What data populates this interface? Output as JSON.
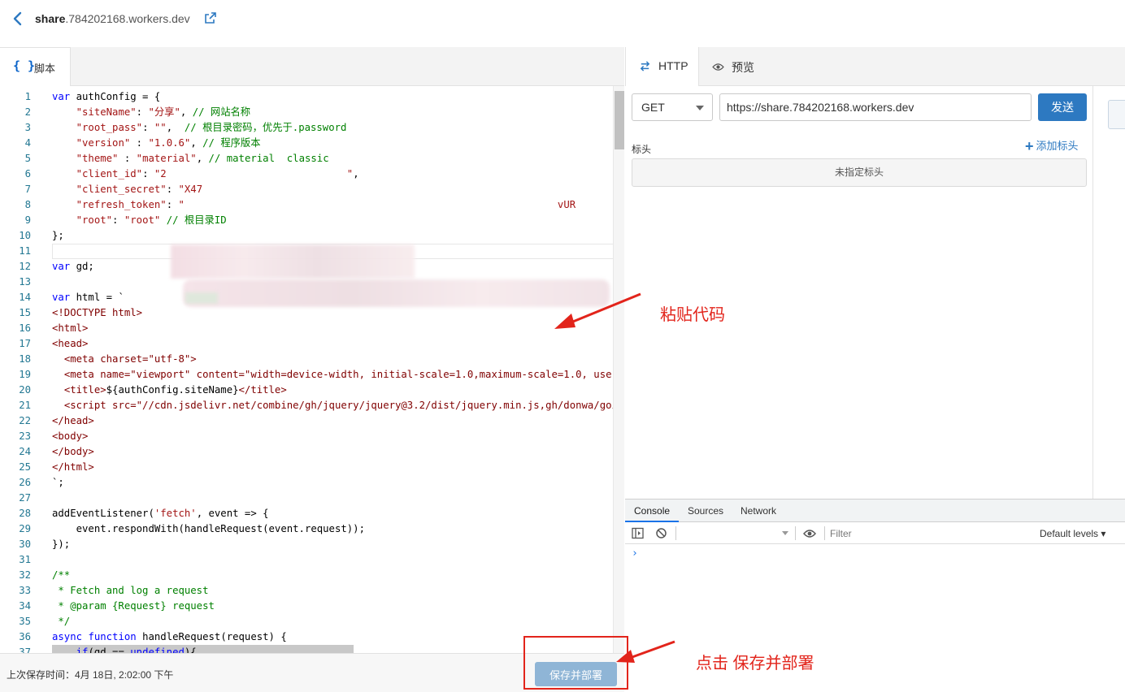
{
  "header": {
    "site_bold": "share",
    "site_rest": ".784202168.workers.dev"
  },
  "editor": {
    "tab_braces": "{ }",
    "tab_label": "脚本",
    "lines": [
      {
        "n": "1",
        "html": "<span class=\"k\">var</span> authConfig = {"
      },
      {
        "n": "2",
        "html": "    <span class=\"s\">\"siteName\"</span>: <span class=\"s\">\"分享\"</span>, <span class=\"c\">// 网站名称</span>"
      },
      {
        "n": "3",
        "html": "    <span class=\"s\">\"root_pass\"</span>: <span class=\"s\">\"\"</span>,  <span class=\"c\">// 根目录密码，优先于.password</span>"
      },
      {
        "n": "4",
        "html": "    <span class=\"s\">\"version\"</span> : <span class=\"s\">\"1.0.6\"</span>, <span class=\"c\">// 程序版本</span>"
      },
      {
        "n": "5",
        "html": "    <span class=\"s\">\"theme\"</span> : <span class=\"s\">\"material\"</span>, <span class=\"c\">// material  classic</span>"
      },
      {
        "n": "6",
        "html": "    <span class=\"s\">\"client_id\"</span>: <span class=\"s\">\"2                              \"</span>,"
      },
      {
        "n": "7",
        "html": "    <span class=\"s\">\"client_secret\"</span>: <span class=\"s\">\"X47</span>"
      },
      {
        "n": "8",
        "html": "    <span class=\"s\">\"refresh_token\"</span>: <span class=\"s\">\"                                                              vUR</span>"
      },
      {
        "n": "9",
        "html": "    <span class=\"s\">\"root\"</span>: <span class=\"s\">\"root\"</span> <span class=\"c\">// 根目录ID</span>"
      },
      {
        "n": "10",
        "html": "};"
      },
      {
        "n": "11",
        "html": "",
        "current": true
      },
      {
        "n": "12",
        "html": "<span class=\"k\">var</span> gd;"
      },
      {
        "n": "13",
        "html": ""
      },
      {
        "n": "14",
        "html": "<span class=\"k\">var</span> html = `"
      },
      {
        "n": "15",
        "html": "<span class=\"t\">&lt;!DOCTYPE html&gt;</span>"
      },
      {
        "n": "16",
        "html": "<span class=\"t\">&lt;html&gt;</span>"
      },
      {
        "n": "17",
        "html": "<span class=\"t\">&lt;head&gt;</span>"
      },
      {
        "n": "18",
        "html": "  <span class=\"t\">&lt;meta charset=\"utf-8\"&gt;</span>"
      },
      {
        "n": "19",
        "html": "  <span class=\"t\">&lt;meta name=\"viewport\" content=\"width=device-width, initial-scale=1.0,maximum-scale=1.0, user-scalable=no\"/&gt;</span>"
      },
      {
        "n": "20",
        "html": "  <span class=\"t\">&lt;title&gt;</span>${authConfig.siteName}<span class=\"t\">&lt;/title&gt;</span>"
      },
      {
        "n": "21",
        "html": "  <span class=\"t\">&lt;script src=\"//cdn.jsdelivr.net/combine/gh/jquery/jquery@3.2/dist/jquery.min.js,gh/donwa/goindex\"&gt;</span>"
      },
      {
        "n": "22",
        "html": "<span class=\"t\">&lt;/head&gt;</span>"
      },
      {
        "n": "23",
        "html": "<span class=\"t\">&lt;body&gt;</span>"
      },
      {
        "n": "24",
        "html": "<span class=\"t\">&lt;/body&gt;</span>"
      },
      {
        "n": "25",
        "html": "<span class=\"t\">&lt;/html&gt;</span>"
      },
      {
        "n": "26",
        "html": "`;"
      },
      {
        "n": "27",
        "html": ""
      },
      {
        "n": "28",
        "html": "addEventListener(<span class=\"s\">'fetch'</span>, event =&gt; {"
      },
      {
        "n": "29",
        "html": "    event.respondWith(handleRequest(event.request));"
      },
      {
        "n": "30",
        "html": "});"
      },
      {
        "n": "31",
        "html": ""
      },
      {
        "n": "32",
        "html": "<span class=\"c\">/**</span>"
      },
      {
        "n": "33",
        "html": "<span class=\"c\"> * Fetch and log a request</span>"
      },
      {
        "n": "34",
        "html": "<span class=\"c\"> * @param {Request} request</span>"
      },
      {
        "n": "35",
        "html": "<span class=\"c\"> */</span>"
      },
      {
        "n": "36",
        "html": "<span class=\"k\">async</span> <span class=\"k\">function</span> handleRequest(request) {"
      },
      {
        "n": "37",
        "html": "    <span class=\"k\">if</span>(gd == <span class=\"k\">undefined</span>){",
        "sel": true
      }
    ]
  },
  "footer": {
    "last_saved": "上次保存时间：4月 18日, 2:02:00 下午",
    "save_label": "保存并部署"
  },
  "right_tabs": {
    "http": "HTTP",
    "preview": "预览"
  },
  "http": {
    "method": "GET",
    "url": "https://share.784202168.workers.dev",
    "send_label": "发送",
    "headers_label": "标头",
    "add_header": "添加标头",
    "no_headers": "未指定标头"
  },
  "devtools": {
    "tabs": [
      "Console",
      "Sources",
      "Network"
    ],
    "filter_placeholder": "Filter",
    "levels": "Default levels ▾",
    "prompt": "›"
  },
  "annotations": {
    "paste_code": "粘贴代码",
    "click_save": "点击  保存并部署"
  }
}
